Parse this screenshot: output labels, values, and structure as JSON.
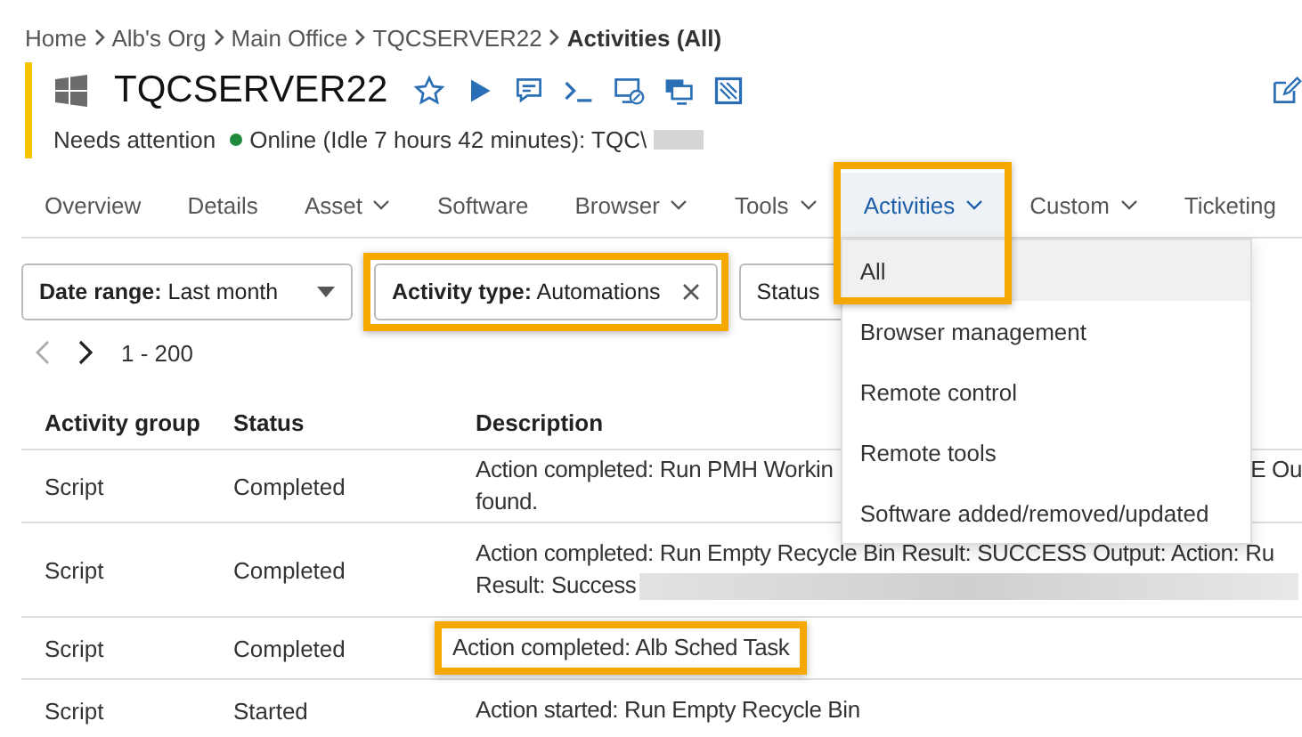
{
  "breadcrumb": [
    {
      "label": "Home",
      "current": false
    },
    {
      "label": "Alb's Org",
      "current": false
    },
    {
      "label": "Main Office",
      "current": false
    },
    {
      "label": "TQCSERVER22",
      "current": false
    },
    {
      "label": "Activities (All)",
      "current": true
    }
  ],
  "device": {
    "name": "TQCSERVER22",
    "alert": "Needs attention",
    "online": true,
    "status": "Online (Idle 7 hours 42 minutes): TQC\\"
  },
  "tabs": [
    {
      "label": "Overview",
      "has_menu": false,
      "selected": false,
      "highlighted": false
    },
    {
      "label": "Details",
      "has_menu": false,
      "selected": false,
      "highlighted": false
    },
    {
      "label": "Asset",
      "has_menu": true,
      "selected": false,
      "highlighted": false
    },
    {
      "label": "Software",
      "has_menu": false,
      "selected": false,
      "highlighted": false
    },
    {
      "label": "Browser",
      "has_menu": true,
      "selected": false,
      "highlighted": false
    },
    {
      "label": "Tools",
      "has_menu": true,
      "selected": false,
      "highlighted": false
    },
    {
      "label": "Activities",
      "has_menu": true,
      "selected": true,
      "highlighted": true
    },
    {
      "label": "Custom",
      "has_menu": true,
      "selected": false,
      "highlighted": false
    },
    {
      "label": "Ticketing",
      "has_menu": false,
      "selected": false,
      "highlighted": false
    }
  ],
  "menu": {
    "items": [
      {
        "label": "All",
        "selected": true
      },
      {
        "label": "Browser management",
        "selected": false
      },
      {
        "label": "Remote control",
        "selected": false
      },
      {
        "label": "Remote tools",
        "selected": false
      },
      {
        "label": "Software added/removed/updated",
        "selected": false
      }
    ]
  },
  "filters": [
    {
      "kind": "dropdown",
      "label": "Date range:",
      "value": "Last month",
      "highlighted": false
    },
    {
      "kind": "removable",
      "label": "Activity type:",
      "value": "Automations",
      "highlighted": true
    },
    {
      "kind": "plain",
      "label": "Status",
      "highlighted": false
    }
  ],
  "pager": {
    "range": "1 - 200"
  },
  "table": {
    "columns": [
      "Activity group",
      "Status",
      "Description"
    ],
    "rows": [
      {
        "group": "Script",
        "status": "Completed",
        "lines": [
          "Action completed: Run PMH Workin",
          "found."
        ],
        "tail": "E Ou",
        "redacted": false,
        "highlighted": false
      },
      {
        "group": "Script",
        "status": "Completed",
        "lines": [
          "Action completed: Run Empty Recycle Bin Result: SUCCESS Output: Action: Ru",
          "Result: Success"
        ],
        "redacted": true,
        "highlighted": false
      },
      {
        "group": "Script",
        "status": "Completed",
        "lines": [
          "Action completed: Alb Sched Task"
        ],
        "redacted": false,
        "highlighted": true
      },
      {
        "group": "Script",
        "status": "Started",
        "lines": [
          "Action started: Run Empty Recycle Bin"
        ],
        "redacted": false,
        "highlighted": false
      }
    ]
  }
}
